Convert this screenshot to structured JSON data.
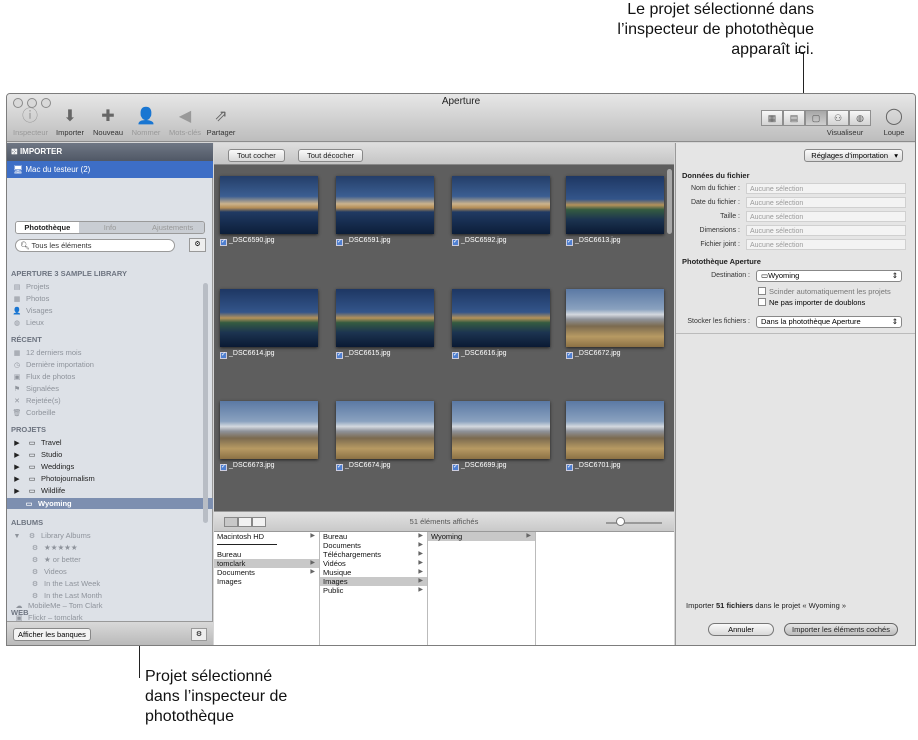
{
  "callouts": {
    "top_line1": "Le projet sélectionné dans",
    "top_line2": "l’inspecteur de photothèque",
    "top_line3": "apparaît ici.",
    "bottom_line1": "Projet sélectionné",
    "bottom_line2": "dans l’inspecteur de",
    "bottom_line3": "photothèque"
  },
  "window": {
    "title": "Aperture"
  },
  "toolbar": {
    "inspecteur": "Inspecteur",
    "importer": "Importer",
    "nouveau": "Nouveau",
    "nommer": "Nommer",
    "mots_cles": "Mots-clés",
    "partager": "Partager",
    "visualiseur": "Visualiseur",
    "loupe": "Loupe"
  },
  "left": {
    "importer_header": "IMPORTER",
    "device": "Mac du testeur (2)",
    "tabs": [
      "Photothèque",
      "Info",
      "Ajustements"
    ],
    "search": "Tous les éléments",
    "sections": {
      "library": "APERTURE 3 SAMPLE LIBRARY",
      "recent": "RÉCENT",
      "projects": "PROJETS",
      "albums": "ALBUMS",
      "web": "WEB"
    },
    "library_items": [
      "Projets",
      "Photos",
      "Visages",
      "Lieux"
    ],
    "recent_items": [
      "12 derniers mois",
      "Dernière importation",
      "Flux de photos",
      "Signalées",
      "Rejetée(s)",
      "Corbeille"
    ],
    "project_items": [
      "Travel",
      "Studio",
      "Weddings",
      "Photojournalism",
      "Wildlife",
      "Wyoming"
    ],
    "album_items": [
      "Library Albums",
      "★★★★★",
      "★ or better",
      "Videos",
      "In the Last Week",
      "In the Last Month"
    ],
    "web_items": [
      "MobileMe – Tom Clark",
      "Flickr – tomclark"
    ],
    "afficher": "Afficher les banques"
  },
  "center": {
    "tout_cocher": "Tout cocher",
    "tout_decocher": "Tout décocher",
    "thumbs": [
      {
        "name": "_DSC6590.jpg"
      },
      {
        "name": "_DSC6591.jpg"
      },
      {
        "name": "_DSC6592.jpg"
      },
      {
        "name": "_DSC6613.jpg"
      },
      {
        "name": "_DSC6614.jpg"
      },
      {
        "name": "_DSC6615.jpg"
      },
      {
        "name": "_DSC6616.jpg"
      },
      {
        "name": "_DSC6672.jpg"
      },
      {
        "name": "_DSC6673.jpg"
      },
      {
        "name": "_DSC6674.jpg"
      },
      {
        "name": "_DSC6699.jpg"
      },
      {
        "name": "_DSC6701.jpg"
      }
    ],
    "count": "51 éléments affichés",
    "browser": {
      "col1": [
        "Macintosh HD",
        "",
        "Bureau",
        "tomclark",
        "Documents",
        "Images"
      ],
      "col2": [
        "Bureau",
        "Documents",
        "Téléchargements",
        "Vidéos",
        "Musique",
        "Images",
        "Public"
      ],
      "col3": [
        "Wyoming"
      ]
    }
  },
  "right": {
    "reglages": "Réglages d’importation",
    "file_header": "Données du fichier",
    "fields": [
      {
        "k": "Nom du fichier :",
        "v": "Aucune sélection"
      },
      {
        "k": "Date du fichier :",
        "v": "Aucune sélection"
      },
      {
        "k": "Taille :",
        "v": "Aucune sélection"
      },
      {
        "k": "Dimensions :",
        "v": "Aucune sélection"
      },
      {
        "k": "Fichier joint :",
        "v": "Aucune sélection"
      }
    ],
    "lib_header": "Photothèque Aperture",
    "destination_label": "Destination :",
    "destination_value": "Wyoming",
    "split": "Scinder automatiquement les projets",
    "no_dup": "Ne pas importer de doublons",
    "store_label": "Stocker les fichiers :",
    "store_value": "Dans la photothèque Aperture",
    "import_info_pre": "Importer ",
    "import_info_count": "51 fichiers",
    "import_info_post": " dans le projet « Wyoming »",
    "annuler": "Annuler",
    "importer_coches": "Importer les éléments cochés"
  }
}
